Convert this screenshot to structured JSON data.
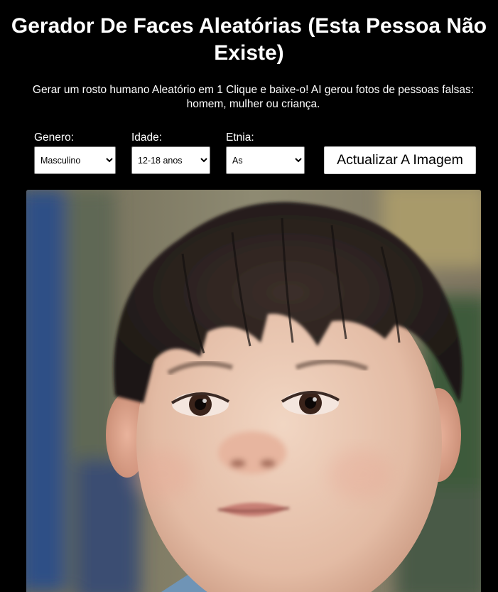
{
  "header": {
    "title": "Gerador De Faces Aleatórias (Esta Pessoa Não Existe)",
    "subtitle": "Gerar um rosto humano Aleatório em 1 Clique e baixe-o! AI gerou fotos de pessoas falsas: homem, mulher ou criança."
  },
  "filters": {
    "gender": {
      "label": "Genero:",
      "selected": "Masculino"
    },
    "age": {
      "label": "Idade:",
      "selected": "12-18 anos"
    },
    "ethnicity": {
      "label": "Etnia:",
      "selected": "As"
    }
  },
  "actions": {
    "refresh_label": "Actualizar A Imagem"
  }
}
